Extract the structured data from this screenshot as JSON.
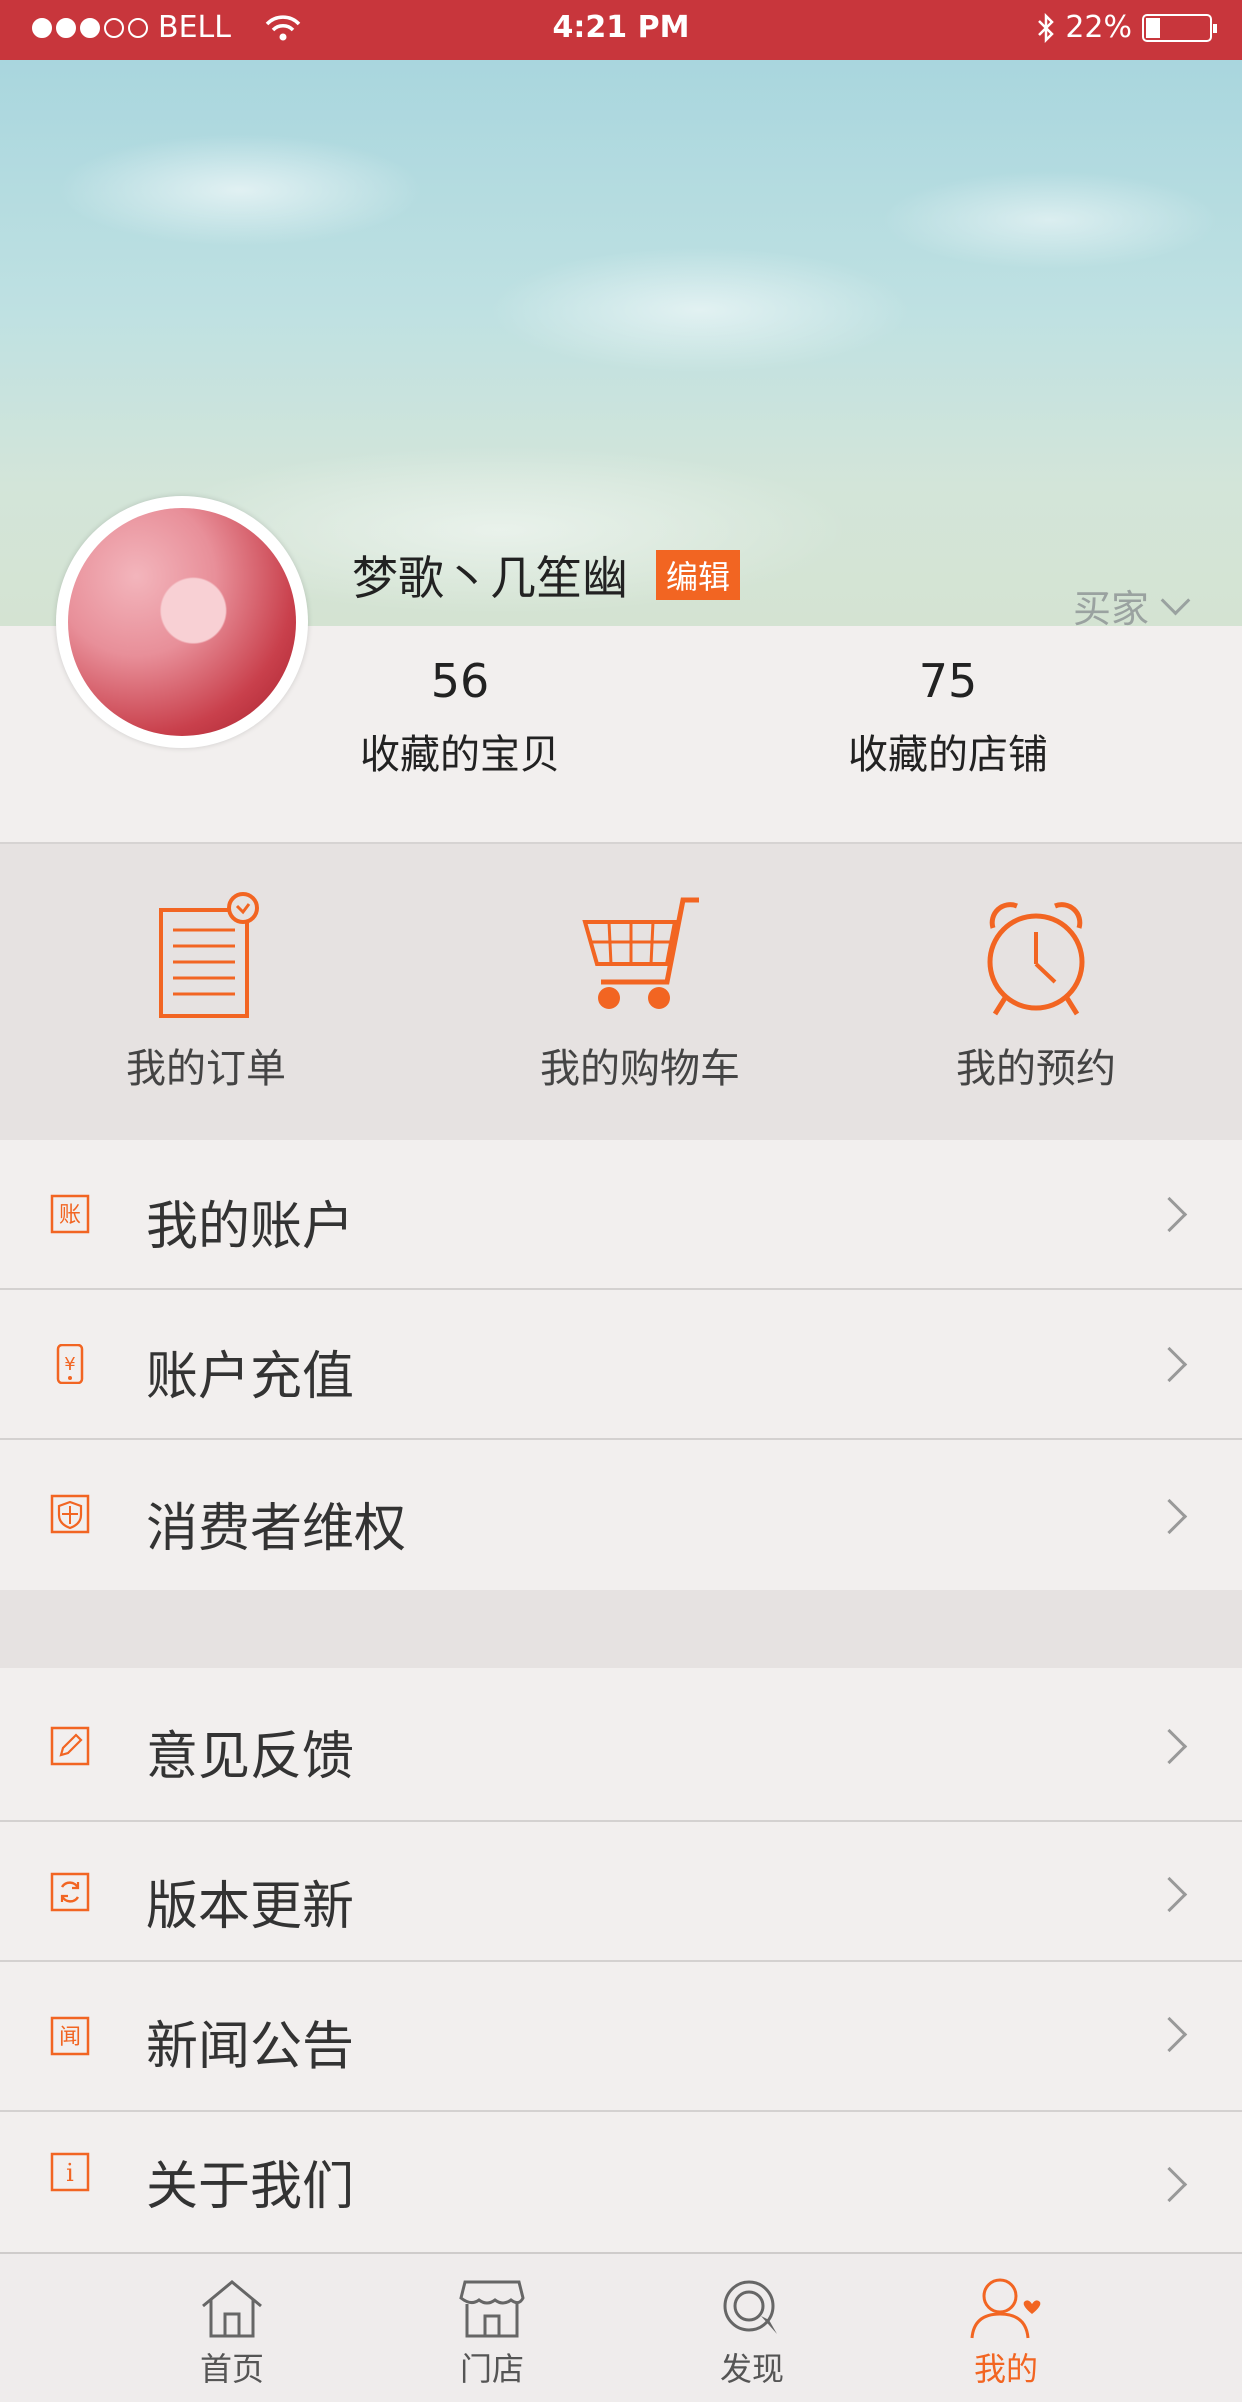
{
  "status_bar": {
    "carrier": "BELL",
    "time": "4:21 PM",
    "battery_text": "22%",
    "battery_level": 0.22
  },
  "profile": {
    "username": "梦歌丶几笙幽",
    "edit_label": "编辑",
    "role_label": "买家",
    "stats": [
      {
        "value": "56",
        "label": "收藏的宝贝"
      },
      {
        "value": "75",
        "label": "收藏的店铺"
      }
    ]
  },
  "shortcuts": [
    {
      "label": "我的订单",
      "icon": "order-list-icon"
    },
    {
      "label": "我的购物车",
      "icon": "cart-icon"
    },
    {
      "label": "我的预约",
      "icon": "alarm-clock-icon"
    }
  ],
  "menu_group1": [
    {
      "label": "我的账户",
      "icon": "account-icon",
      "glyph": "账"
    },
    {
      "label": "账户充值",
      "icon": "phone-recharge-icon",
      "glyph": "¥"
    },
    {
      "label": "消费者维权",
      "icon": "shield-icon",
      "glyph": ""
    }
  ],
  "menu_group2": [
    {
      "label": "意见反馈",
      "icon": "pencil-icon",
      "glyph": ""
    },
    {
      "label": "版本更新",
      "icon": "refresh-icon",
      "glyph": ""
    },
    {
      "label": "新闻公告",
      "icon": "news-icon",
      "glyph": "闻"
    },
    {
      "label": "关于我们",
      "icon": "info-icon",
      "glyph": "i"
    }
  ],
  "tabbar": [
    {
      "label": "首页",
      "icon": "home-icon",
      "active": false
    },
    {
      "label": "门店",
      "icon": "store-icon",
      "active": false
    },
    {
      "label": "发现",
      "icon": "discover-icon",
      "active": false
    },
    {
      "label": "我的",
      "icon": "user-icon",
      "active": true
    }
  ],
  "colors": {
    "status_bar": "#c8363c",
    "accent": "#f26522",
    "background": "#f2efee",
    "section_bg": "#e6e2e1"
  }
}
